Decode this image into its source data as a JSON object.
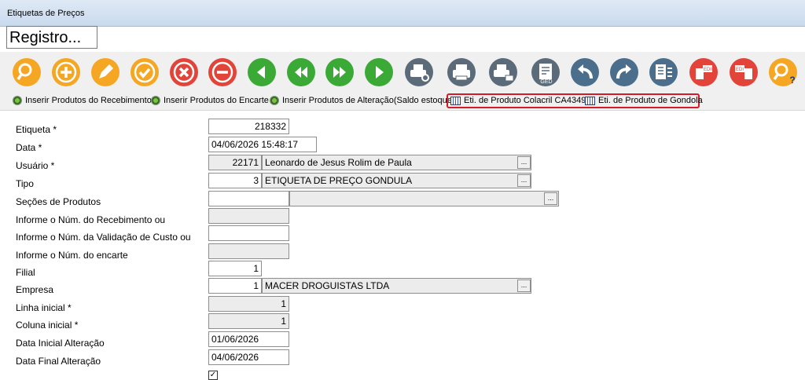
{
  "window": {
    "title": "Etiquetas de Preços"
  },
  "registro_label": "Registro...",
  "toolbar": {
    "buttons": [
      {
        "name": "search-icon",
        "color": "#f5a623"
      },
      {
        "name": "add-icon",
        "color": "#f5a623"
      },
      {
        "name": "edit-icon",
        "color": "#f5a623"
      },
      {
        "name": "confirm-icon",
        "color": "#f5a623"
      },
      {
        "name": "cancel-icon",
        "color": "#e2443a"
      },
      {
        "name": "remove-icon",
        "color": "#e2443a"
      },
      {
        "name": "previous-icon",
        "color": "#3aa935"
      },
      {
        "name": "first-icon",
        "color": "#3aa935"
      },
      {
        "name": "last-icon",
        "color": "#3aa935"
      },
      {
        "name": "next-icon",
        "color": "#3aa935"
      },
      {
        "name": "print-preview-icon",
        "color": "#5b6b7a"
      },
      {
        "name": "print-icon",
        "color": "#5b6b7a"
      },
      {
        "name": "print-email-icon",
        "color": "#5b6b7a"
      },
      {
        "name": "ged-document-icon",
        "color": "#5b6b7a"
      },
      {
        "name": "undo-icon",
        "color": "#4a6e8c"
      },
      {
        "name": "redo-icon",
        "color": "#4a6e8c"
      },
      {
        "name": "export-list-icon",
        "color": "#4a6e8c"
      },
      {
        "name": "edi-import-icon",
        "color": "#e2443a"
      },
      {
        "name": "edi-export-icon",
        "color": "#e2443a"
      },
      {
        "name": "help-icon",
        "color": "#f5a623"
      }
    ]
  },
  "links": {
    "inserir_recebimento": "Inserir Produtos do Recebimento",
    "inserir_encarte": "Inserir Produtos do Encarte",
    "inserir_alteracao": "Inserir Produtos de Alteração(Saldo estoque)",
    "eti_colacril": "Eti. de Produto Colacril CA4349",
    "eti_gondola": "Eti. de Produto de Gondola"
  },
  "form": {
    "etiqueta": {
      "label": "Etiqueta *",
      "value": "218332"
    },
    "data": {
      "label": "Data *",
      "value": "04/06/2026 15:48:17"
    },
    "usuario": {
      "label": "Usuário *",
      "code": "22171",
      "name": "Leonardo de Jesus Rolim de Paula"
    },
    "tipo": {
      "label": "Tipo",
      "code": "3",
      "name": "ETIQUETA DE PREÇO GONDULA"
    },
    "secoes": {
      "label": "Seções de Produtos",
      "code": "",
      "name": ""
    },
    "recebimento": {
      "label": "Informe o Núm. do Recebimento ou",
      "value": ""
    },
    "validacao": {
      "label": "Informe o Núm. da Validação de Custo ou",
      "value": ""
    },
    "encarte": {
      "label": "Informe o Núm. do encarte",
      "value": ""
    },
    "filial": {
      "label": "Filial",
      "value": "1"
    },
    "empresa": {
      "label": "Empresa",
      "code": "1",
      "name": "MACER DROGUISTAS LTDA"
    },
    "linha": {
      "label": "Linha inicial *",
      "value": "1"
    },
    "coluna": {
      "label": "Coluna inicial *",
      "value": "1"
    },
    "data_inicial": {
      "label": "Data Inicial Alteração",
      "value": "01/06/2026"
    },
    "data_final": {
      "label": "Data Final Alteração",
      "value": "04/06/2026"
    },
    "checkbox_value": "✓"
  },
  "ellipsis": "..."
}
